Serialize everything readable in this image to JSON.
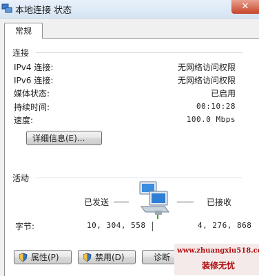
{
  "window": {
    "title": "本地连接 状态",
    "close_label": "✕"
  },
  "tabs": [
    {
      "label": "常规"
    }
  ],
  "connection": {
    "heading": "连接",
    "rows": [
      {
        "label": "IPv4 连接:",
        "value": "无网络访问权限"
      },
      {
        "label": "IPv6 连接:",
        "value": "无网络访问权限"
      },
      {
        "label": "媒体状态:",
        "value": "已启用"
      },
      {
        "label": "持续时间:",
        "value": "00:10:28"
      },
      {
        "label": "速度:",
        "value": "100.0 Mbps"
      }
    ],
    "details_button": "详细信息(E)..."
  },
  "activity": {
    "heading": "活动",
    "sent_label": "已发送",
    "received_label": "已接收",
    "bytes_label": "字节:",
    "bytes_sent": "10, 304, 558",
    "bytes_received": "4, 276, 868"
  },
  "buttons": {
    "properties": "属性(P)",
    "disable": "禁用(D)",
    "diagnose": "诊断"
  },
  "watermark": {
    "url": "www.zhuangxiu518.com",
    "text": "装修无忧"
  },
  "colors": {
    "title_bar": "#d5e4f3",
    "close_button": "#c6452b",
    "watermark": "#b01010"
  }
}
